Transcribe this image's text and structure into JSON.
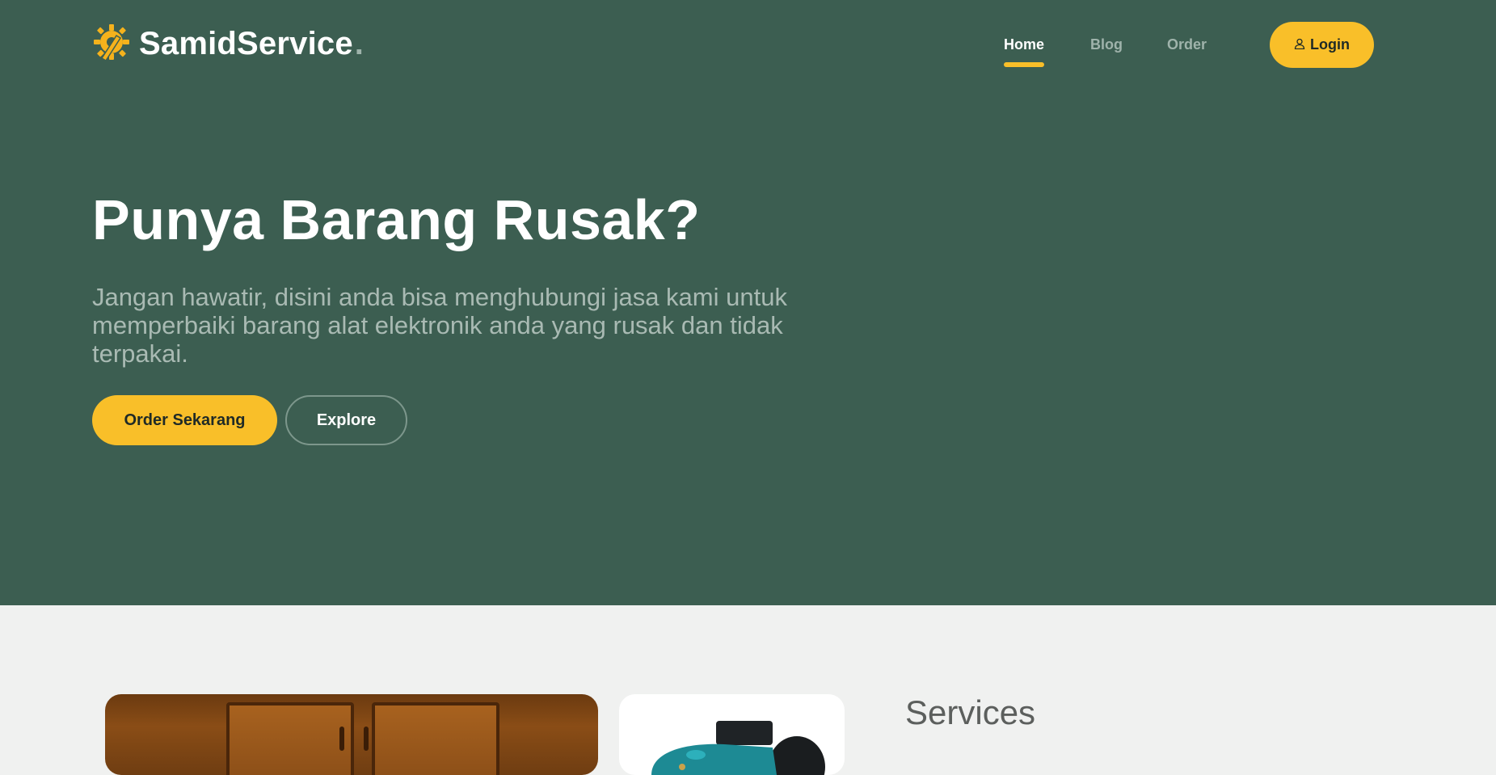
{
  "brand": {
    "name": "SamidService",
    "dot": ".",
    "logo_icon": "gear-tool-icon"
  },
  "nav": {
    "items": [
      {
        "label": "Home",
        "active": true
      },
      {
        "label": "Blog",
        "active": false
      },
      {
        "label": "Order",
        "active": false
      }
    ],
    "login_label": "Login",
    "login_icon": "user-icon"
  },
  "hero": {
    "title": "Punya Barang Rusak?",
    "subtitle": "Jangan hawatir, disini anda bisa menghubungi jasa kami untuk memperbaiki barang alat elektronik anda yang rusak dan tidak terpakai.",
    "primary_button": "Order Sekarang",
    "secondary_button": "Explore"
  },
  "services": {
    "title": "Services"
  },
  "colors": {
    "hero_bg": "#3c5e51",
    "accent": "#f9bf29",
    "page_bg": "#f0f1f0",
    "muted_text": "#a9bab3"
  }
}
